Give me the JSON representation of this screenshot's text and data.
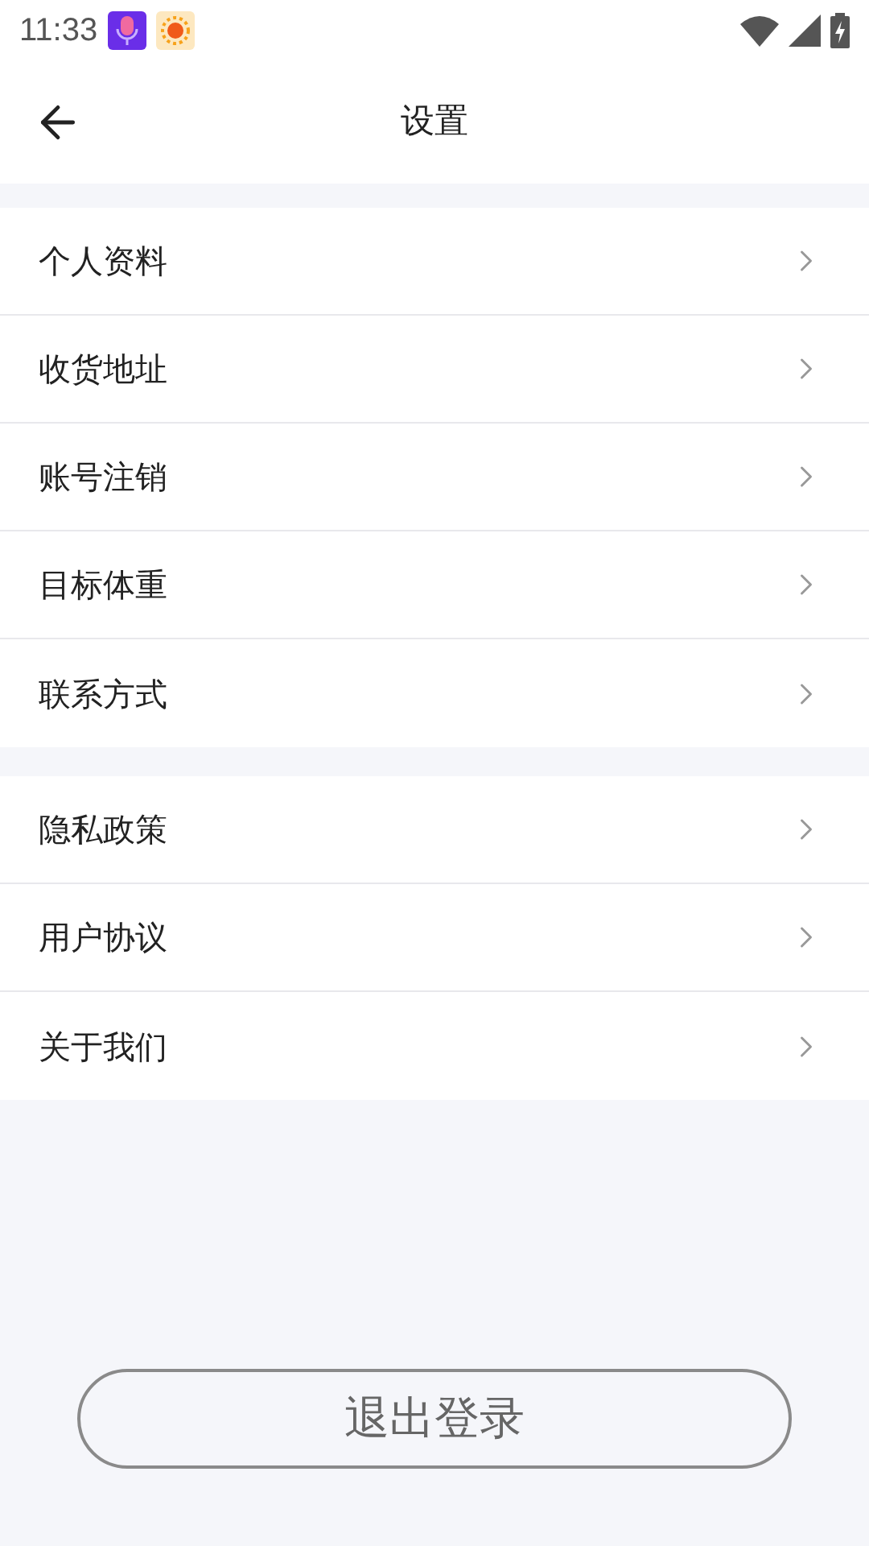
{
  "status_bar": {
    "time": "11:33"
  },
  "header": {
    "title": "设置"
  },
  "groups": [
    {
      "items": [
        {
          "label": "个人资料"
        },
        {
          "label": "收货地址"
        },
        {
          "label": "账号注销"
        },
        {
          "label": "目标体重"
        },
        {
          "label": "联系方式"
        }
      ]
    },
    {
      "items": [
        {
          "label": "隐私政策"
        },
        {
          "label": "用户协议"
        },
        {
          "label": "关于我们"
        }
      ]
    }
  ],
  "logout_button": {
    "label": "退出登录"
  }
}
